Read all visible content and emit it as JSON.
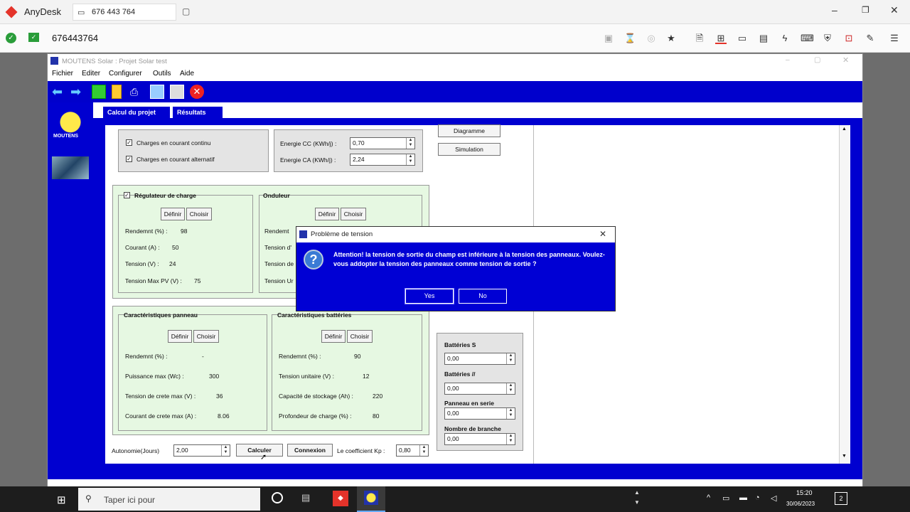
{
  "anydesk": {
    "brand": "AnyDesk",
    "session_tab": "676 443 764",
    "address_id": "676443764"
  },
  "app": {
    "title": "MOUTENS Solar :  Projet Solar test",
    "menu": [
      "Fichier",
      "Editer",
      "Configurer",
      "Outils",
      "Aide"
    ],
    "logo_text": "MOUTENS",
    "tabs": [
      "Calcul du projet",
      "Résultats"
    ]
  },
  "charges": {
    "dc_label": "Charges en courant continu",
    "ac_label": "Charges en courant alternatif",
    "energy_cc_label": "Energie CC (KWh/j) :",
    "energy_cc_value": "0,70",
    "energy_ca_label": "Energie CA (KWh/j) :",
    "energy_ca_value": "2,24"
  },
  "side_buttons": {
    "diagramme": "Diagramme",
    "simulation": "Simulation"
  },
  "regulateur": {
    "title": "Régulateur de charge",
    "define": "Définir",
    "choose": "Choisir",
    "rows": [
      {
        "label": "Rendemnt (%) :",
        "value": "98"
      },
      {
        "label": "Courant (A) :",
        "value": "50"
      },
      {
        "label": "Tension (V) :",
        "value": "24"
      },
      {
        "label": "Tension Max PV (V) :",
        "value": "75"
      }
    ]
  },
  "onduleur": {
    "title": "Onduleur",
    "define": "Définir",
    "choose": "Choisir",
    "rows": [
      "Rendemt",
      "Tension d'",
      "Tension de",
      "Tension Ur"
    ]
  },
  "panneau": {
    "title": "Caractéristiques panneau",
    "define": "Définir",
    "choose": "Choisir",
    "rows": [
      {
        "label": "Rendemnt (%) :",
        "value": "-"
      },
      {
        "label": "Puissance max (Wc) :",
        "value": "300"
      },
      {
        "label": "Tension de crete max (V) :",
        "value": "36"
      },
      {
        "label": "Courant de crete max (A) :",
        "value": "8.06"
      }
    ]
  },
  "batteries": {
    "title": "Caractéristiques battéries",
    "define": "Définir",
    "choose": "Choisir",
    "rows": [
      {
        "label": "Rendemnt (%) :",
        "value": "90"
      },
      {
        "label": "Tension unitaire (V) :",
        "value": "12"
      },
      {
        "label": "Capacité de stockage (Ah) :",
        "value": "220"
      },
      {
        "label": "Profondeur de charge (%) :",
        "value": "80"
      }
    ]
  },
  "config": {
    "rows": [
      {
        "label": "Battéries S",
        "value": "0,00"
      },
      {
        "label": "Battéries //",
        "value": "0,00"
      },
      {
        "label": "Panneau en serie",
        "value": "0,00"
      },
      {
        "label": "Nombre de branche",
        "value": "0,00"
      }
    ]
  },
  "bottom": {
    "autonomie_label": "Autonomie(Jours)",
    "autonomie_value": "2,00",
    "calculer": "Calculer",
    "connexion": "Connexion",
    "kp_label": "Le coefficient Kp :",
    "kp_value": "0,80"
  },
  "dialog": {
    "title": "Problème de tension",
    "message": "Attention! la tension de sortie du champ est inférieure à la tension des panneaux. Voulez-vous addopter la tension des panneaux comme tension de sortie ?",
    "yes": "Yes",
    "no": "No"
  },
  "taskbar": {
    "search_placeholder": "Taper ici pour",
    "time": "15:20",
    "date": "30/06/2023",
    "notif_count": "2"
  }
}
